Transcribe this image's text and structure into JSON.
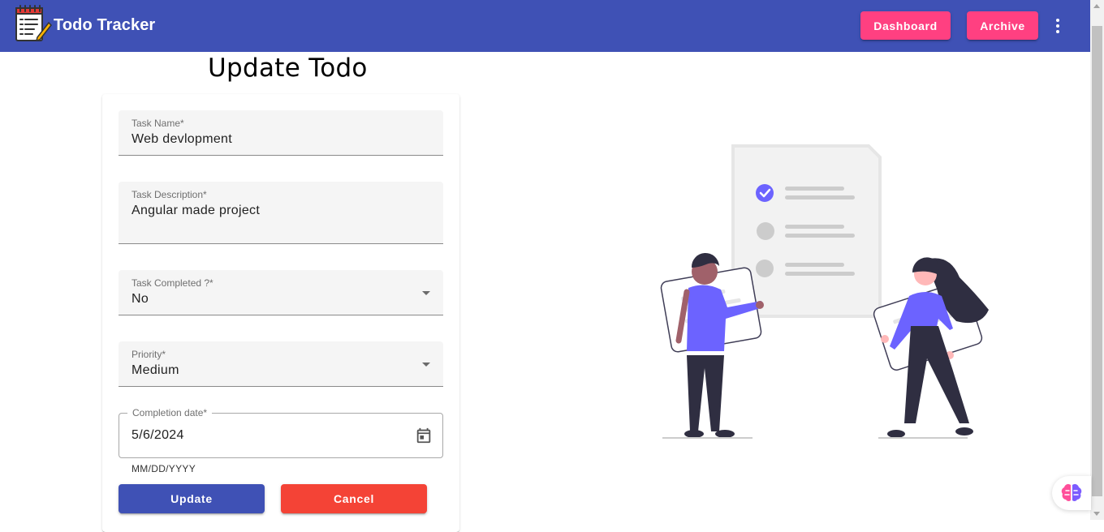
{
  "header": {
    "title": "Todo Tracker",
    "dashboard_label": "Dashboard",
    "archive_label": "Archive"
  },
  "page": {
    "title": "Update Todo"
  },
  "form": {
    "task_name": {
      "label": "Task Name*",
      "value": "Web devlopment"
    },
    "task_description": {
      "label": "Task Description*",
      "value": "Angular made project"
    },
    "task_completed": {
      "label": "Task Completed ?*",
      "value": "No"
    },
    "priority": {
      "label": "Priority*",
      "value": "Medium"
    },
    "completion_date": {
      "label": "Completion date*",
      "value": "5/6/2024",
      "hint": "MM/DD/YYYY"
    },
    "update_label": "Update",
    "cancel_label": "Cancel"
  },
  "colors": {
    "primary": "#3f51b5",
    "accent": "#ff4081",
    "warn": "#f44336",
    "illustration_accent": "#6c63ff"
  },
  "icons": [
    "notepad-logo-icon",
    "more-vert-icon",
    "calendar-icon",
    "dropdown-arrow-icon",
    "brain-icon"
  ]
}
